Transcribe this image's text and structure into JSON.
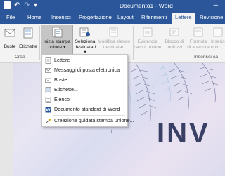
{
  "window": {
    "title": "Documento1 - Word",
    "quick_access": {
      "undo": "↶",
      "redo": "↷",
      "customize": "▾"
    },
    "controls": {
      "minimize": "─",
      "maximize": "□",
      "close": "✕"
    }
  },
  "tabs": [
    {
      "label": "File"
    },
    {
      "label": "Home"
    },
    {
      "label": "Inserisci"
    },
    {
      "label": "Progettazione"
    },
    {
      "label": "Layout"
    },
    {
      "label": "Riferimenti"
    },
    {
      "label": "Lettere",
      "active": true
    },
    {
      "label": "Revisione"
    }
  ],
  "ribbon": {
    "groups": {
      "crea": "Crea",
      "inserisci": "Inserisci ca"
    },
    "buttons": {
      "buste": "Buste",
      "etichette": "Etichette",
      "inizia_l1": "Inizia stampa",
      "inizia_l2": "unione ▾",
      "seleziona_l1": "Seleziona",
      "seleziona_l2": "destinatari ▾",
      "modifica_l1": "Modifica elenco",
      "modifica_l2": "destinatari",
      "evidenzia_l1": "Evidenzia",
      "evidenzia_l2": "campi unione",
      "blocco_l1": "Blocco di",
      "blocco_l2": "indirizzi",
      "formula_l1": "Formula",
      "formula_l2": "di apertura",
      "inserisci_l1": "Inserisc",
      "inserisci_l2": "unio"
    }
  },
  "menu": {
    "items": [
      {
        "label": "Lettere",
        "icon": "letter-icon"
      },
      {
        "label": "Messaggi di posta elettronica",
        "icon": "email-icon"
      },
      {
        "label": "Buste...",
        "icon": "envelope-icon"
      },
      {
        "label": "Etichette...",
        "icon": "label-icon"
      },
      {
        "label": "Elenco",
        "icon": "directory-icon"
      },
      {
        "label": "Documento standard di Word",
        "icon": "word-doc-icon"
      },
      {
        "label": "Creazione guidata stampa unione...",
        "icon": "wizard-icon"
      }
    ]
  },
  "document": {
    "visible_text": "INV"
  },
  "colors": {
    "accent": "#2b579a",
    "ribbon": "#f3f3f3",
    "highlight": "#c5d9f1",
    "heading": "#3a3f66"
  }
}
